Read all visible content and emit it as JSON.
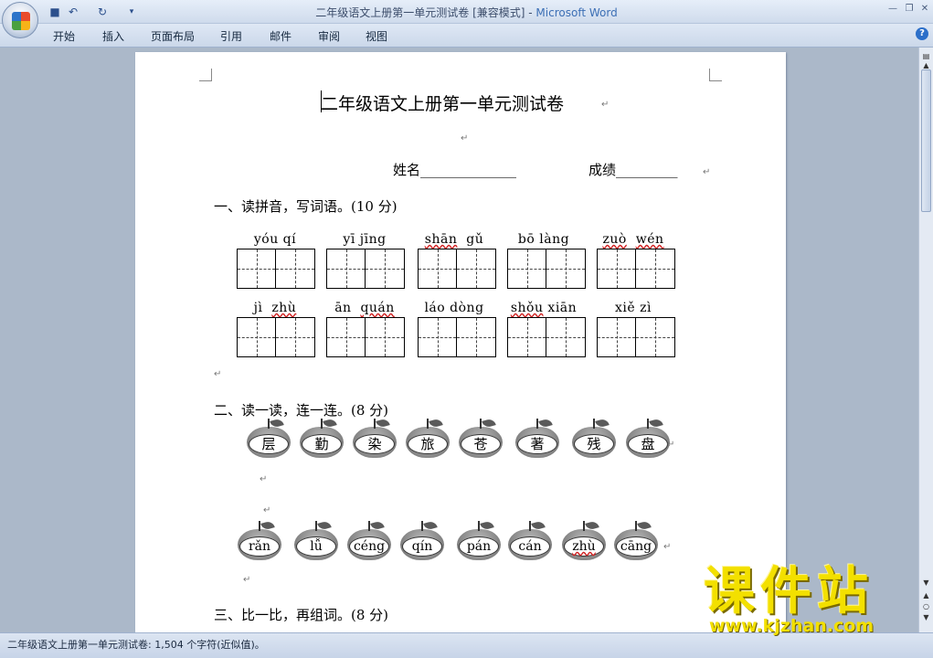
{
  "window": {
    "title": "二年级语文上册第一单元测试卷 [兼容模式] - ",
    "app_name": "Microsoft Word"
  },
  "qat": {
    "save_icon": "save-icon",
    "undo_icon": "undo-icon",
    "redo_icon": "redo-icon"
  },
  "ribbon": {
    "tabs": [
      "开始",
      "插入",
      "页面布局",
      "引用",
      "邮件",
      "审阅",
      "视图"
    ]
  },
  "document": {
    "title": "二年级语文上册第一单元测试卷",
    "name_label": "姓名______________",
    "score_label": "成绩_________",
    "section1": "一、读拼音，写词语。(10 分)",
    "row1_pinyin": [
      "yóu  qí",
      "yī  jīng",
      "shān  gǔ",
      "bō  làng",
      "zuò  wén"
    ],
    "row2_pinyin": [
      "jì  zhù",
      "ān  quán",
      "láo dòng",
      "shǒu xiān",
      "xiě  zì"
    ],
    "section2": "二、读一读，连一连。(8 分)",
    "apples_chars": [
      "层",
      "勤",
      "染",
      "旅",
      "苍",
      "著",
      "残",
      "盘"
    ],
    "apples_pinyin": [
      "rǎn",
      "lǚ",
      "céng",
      "qín",
      "pán",
      "cán",
      "zhù",
      "cāng"
    ],
    "section3": "三、比一比，再组词。(8 分)",
    "para_mark": "↵"
  },
  "statusbar": {
    "text": "二年级语文上册第一单元测试卷: 1,504 个字符(近似值)。"
  },
  "watermark": {
    "main": "课件站",
    "url": "www.kjzhan.com"
  },
  "colors": {
    "accent": "#3c6fb5",
    "watermark": "#f3e000"
  }
}
